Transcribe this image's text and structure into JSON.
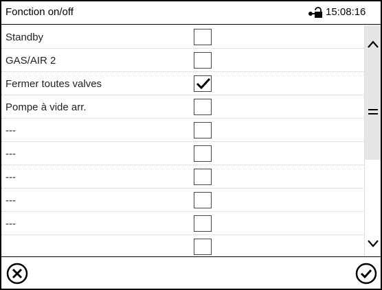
{
  "header": {
    "title": "Fonction on/off",
    "time": "15:08:16",
    "lock_icon": "lock-key-icon"
  },
  "rows": [
    {
      "label": "Standby",
      "checked": false
    },
    {
      "label": "GAS/AIR 2",
      "checked": false
    },
    {
      "label": "Fermer toutes valves",
      "checked": true
    },
    {
      "label": "Pompe à vide arr.",
      "checked": false
    },
    {
      "label": "---",
      "checked": false
    },
    {
      "label": "---",
      "checked": false
    },
    {
      "label": "---",
      "checked": false
    },
    {
      "label": "---",
      "checked": false
    },
    {
      "label": "---",
      "checked": false
    },
    {
      "label": "",
      "checked": false
    }
  ],
  "scrollbar": {
    "up_icon": "chevron-up-icon",
    "handle_icon": "menu-handle-icon",
    "down_icon": "chevron-down-icon"
  },
  "footer": {
    "cancel_icon": "cancel-icon",
    "confirm_icon": "confirm-icon"
  }
}
